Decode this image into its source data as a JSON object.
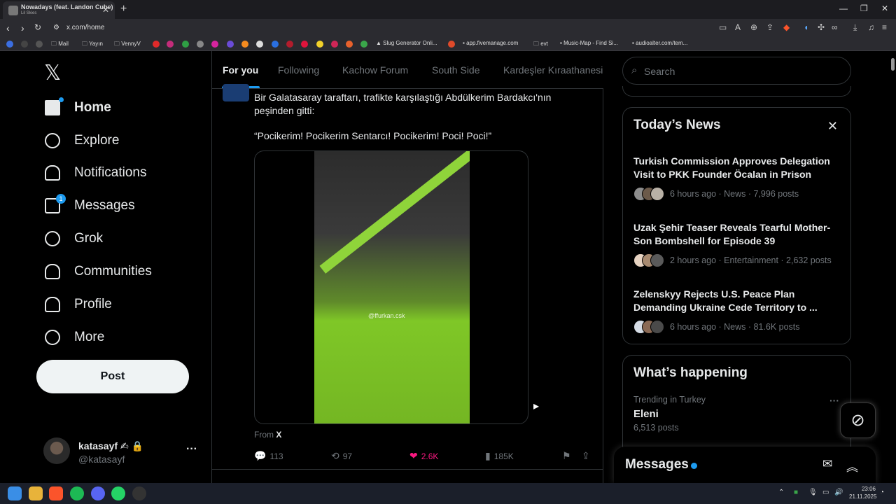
{
  "browser": {
    "tab_title": "Nowadays (feat. Landon Cube)",
    "tab_subtitle": "Lil Skies",
    "url": "x.com/home",
    "bookmarks": [
      "Mail",
      "Yayın",
      "VennyV",
      "Slug Generator Onli...",
      "app.fivemanage.com",
      "evt",
      "Music-Map - Find Si...",
      "audioalter.com/tem..."
    ]
  },
  "sidebar": {
    "items": [
      {
        "label": "Home"
      },
      {
        "label": "Explore"
      },
      {
        "label": "Notifications"
      },
      {
        "label": "Messages",
        "badge": "1"
      },
      {
        "label": "Grok"
      },
      {
        "label": "Communities"
      },
      {
        "label": "Profile"
      },
      {
        "label": "More"
      }
    ],
    "post_button": "Post",
    "account": {
      "name": "katasayf",
      "handle": "@katasayf"
    }
  },
  "feed": {
    "tabs": [
      "For you",
      "Following",
      "Kachow Forum",
      "South Side",
      "Kardeşler Kıraathanesi"
    ],
    "post": {
      "text": "Bir Galatasaray taraftarı, trafikte karşılaştığı Abdülkerim Bardakcı'nın peşinden gitti:",
      "quote": "“Pocikerim! Pocikerim Sentarcı! Pocikerim! Poci! Poci!”",
      "watermark": "@ffurkan.csk",
      "from_label": "From",
      "from_source": "X",
      "replies": "113",
      "reposts": "97",
      "likes": "2.6K",
      "views": "185K"
    }
  },
  "right": {
    "search_placeholder": "Search",
    "todays_news": {
      "title": "Today’s News",
      "items": [
        {
          "title": "Turkish Commission Approves Delegation Visit to PKK Founder Öcalan in Prison",
          "meta": "6 hours ago · News · 7,996 posts"
        },
        {
          "title": "Uzak Şehir Teaser Reveals Tearful Mother-Son Bombshell for Episode 39",
          "meta": "2 hours ago · Entertainment · 2,632 posts"
        },
        {
          "title": "Zelenskyy Rejects U.S. Peace Plan Demanding Ukraine Cede Territory to ...",
          "meta": "6 hours ago · News · 81.6K posts"
        }
      ]
    },
    "whats_happening": {
      "title": "What’s happening",
      "trend_context": "Trending in Turkey",
      "trend_name": "Eleni",
      "trend_count": "6,513 posts"
    },
    "messages_drawer": "Messages"
  },
  "taskbar": {
    "time": "23:06",
    "date": "21.11.2025"
  }
}
